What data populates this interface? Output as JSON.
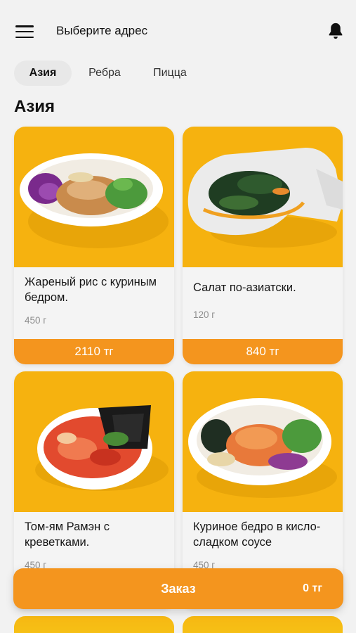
{
  "header": {
    "address_label": "Выберите адрес"
  },
  "tabs": [
    {
      "label": "Азия",
      "active": true
    },
    {
      "label": "Ребра",
      "active": false
    },
    {
      "label": "Пицца",
      "active": false
    }
  ],
  "section": {
    "title": "Азия"
  },
  "products": [
    {
      "name": "Жареный рис с куриным бедром.",
      "weight": "450 г",
      "price": "2110 тг"
    },
    {
      "name": "Салат по-азиатски.",
      "weight": "120 г",
      "price": "840 тг"
    },
    {
      "name": "Том-ям Рамэн с креветками.",
      "weight": "450 г",
      "price": ""
    },
    {
      "name": "Куриное бедро в кисло-сладком соусе",
      "weight": "450 г",
      "price": ""
    }
  ],
  "order": {
    "label": "Заказ",
    "total": "0 тг"
  },
  "colors": {
    "accent": "#f4951e",
    "photo_bg": "#f6b20f",
    "page_bg": "#f2f2f2"
  },
  "icons": [
    "menu-icon",
    "bell-icon"
  ]
}
